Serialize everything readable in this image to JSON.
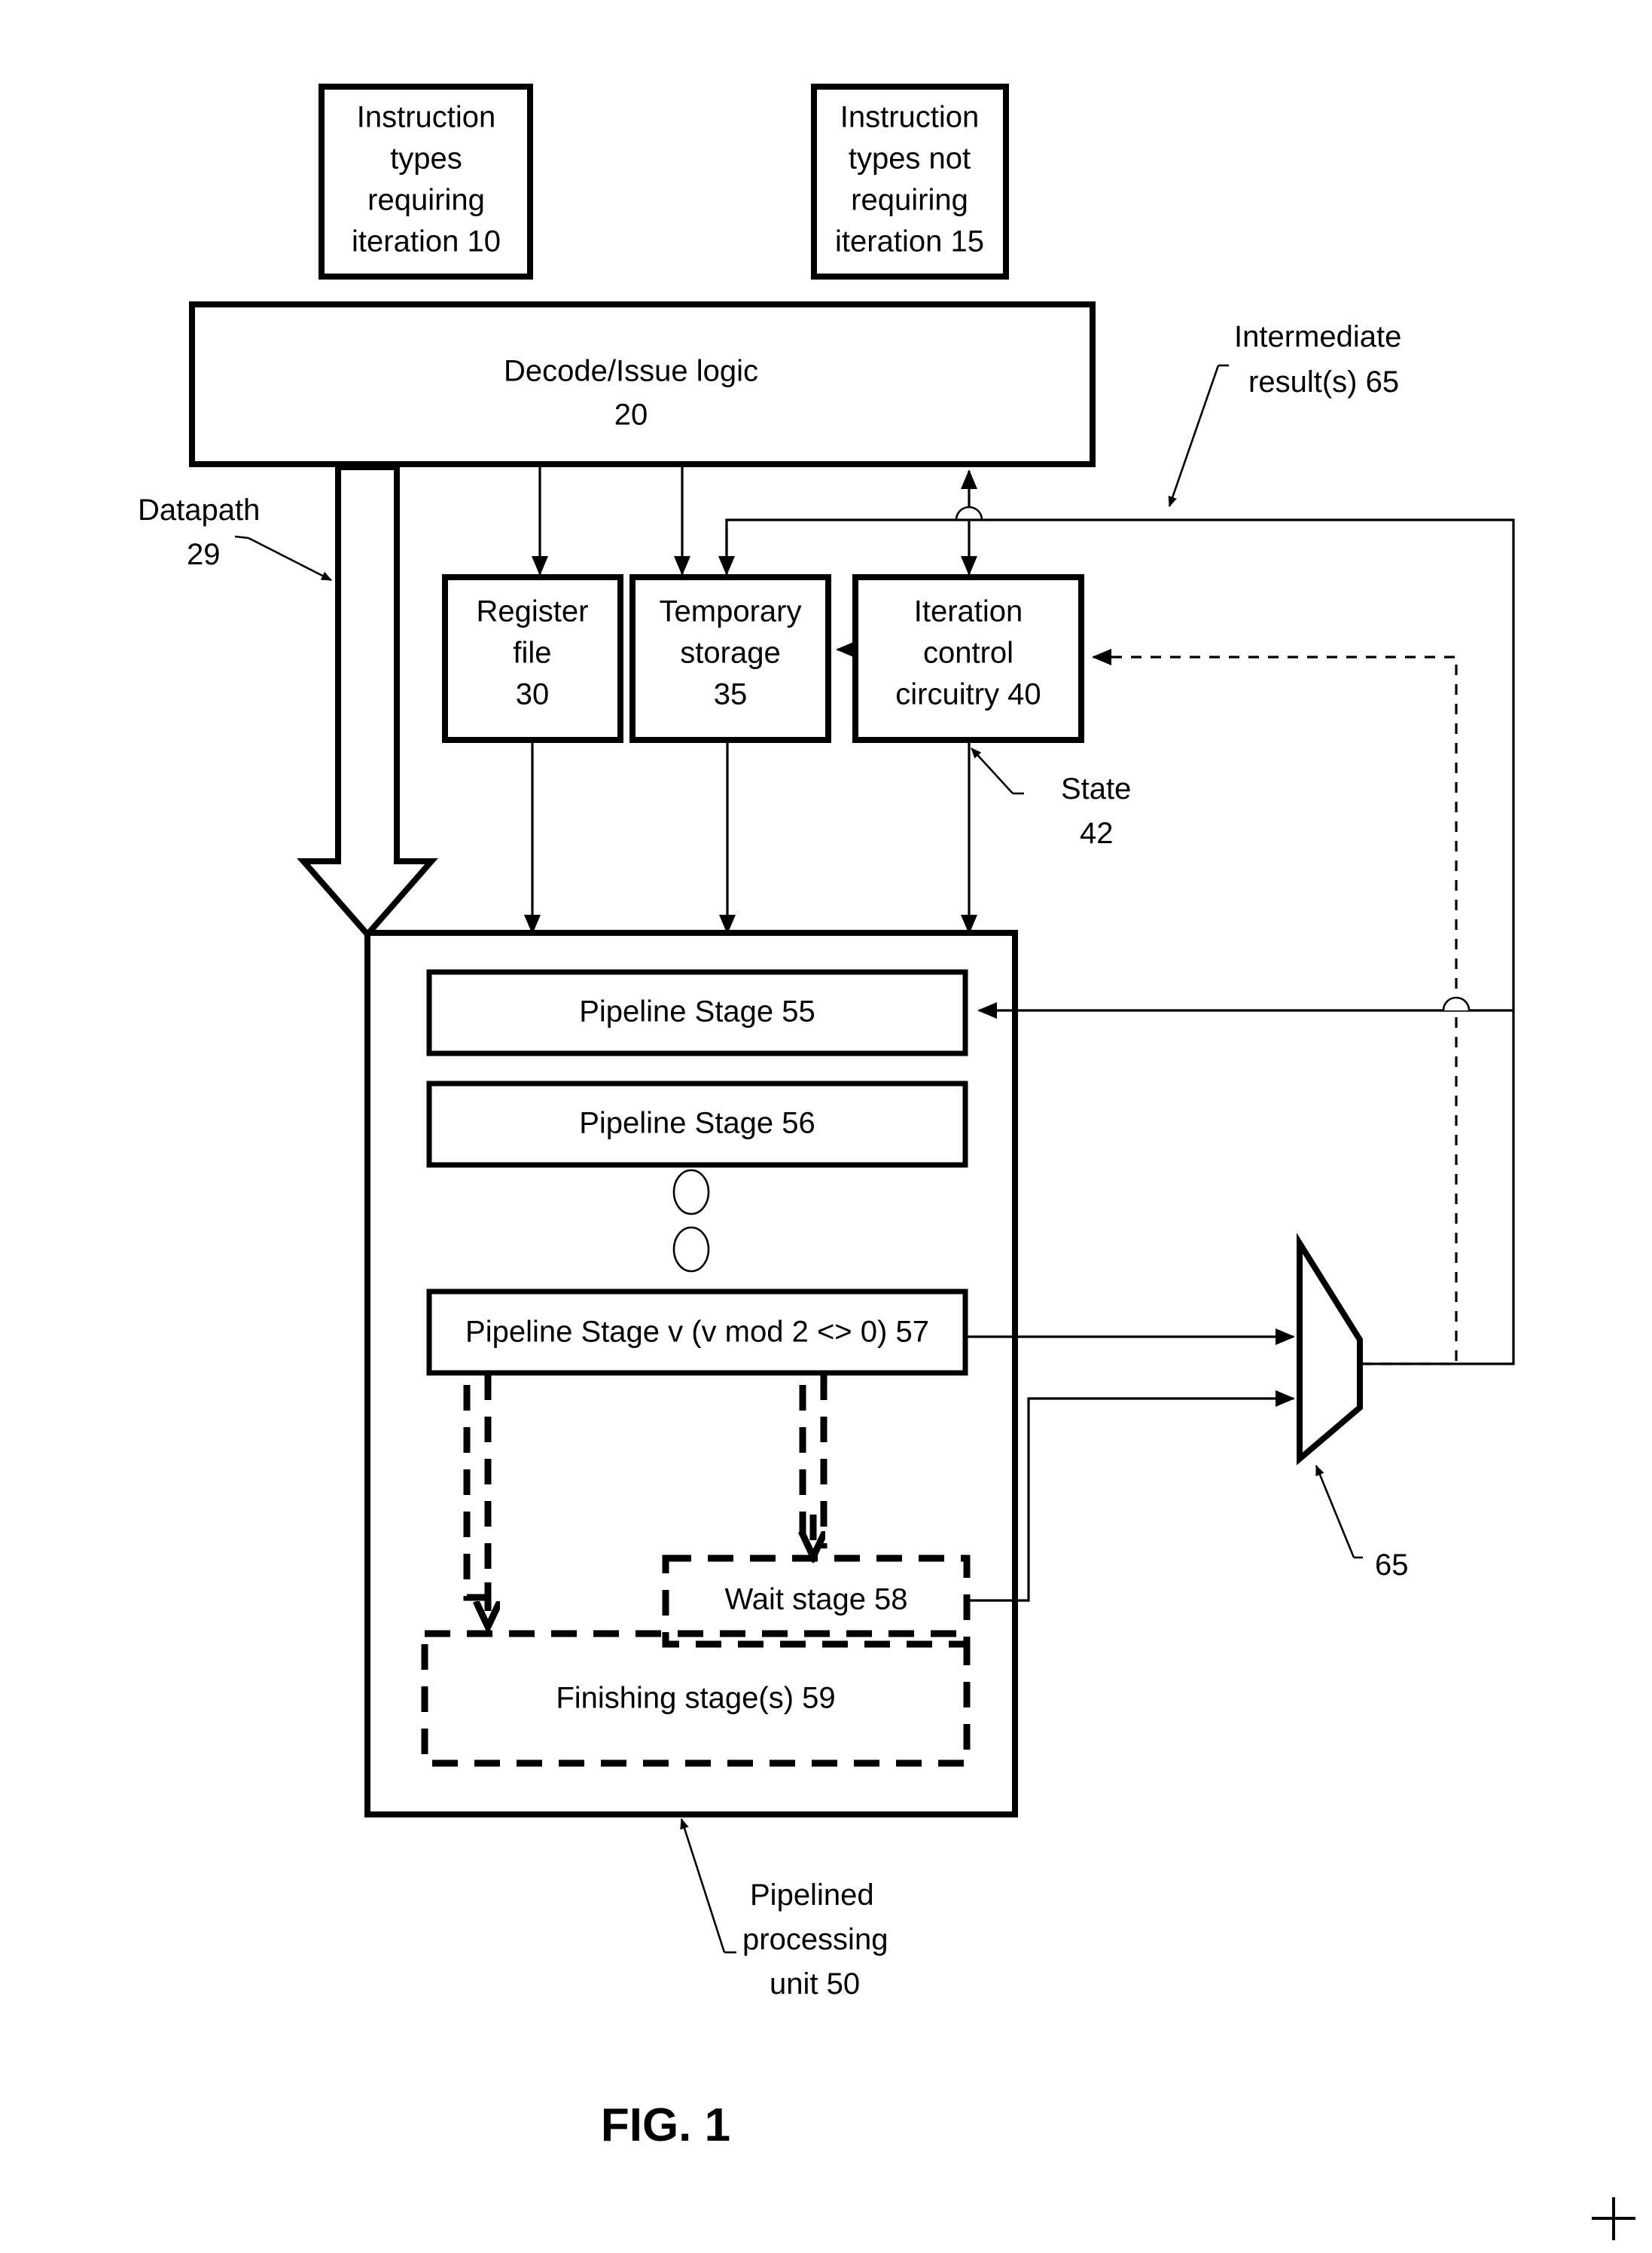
{
  "figure": {
    "caption": "FIG. 1",
    "domain": "patent block diagram"
  },
  "blocks": {
    "instr_iter": {
      "lines": [
        "Instruction",
        "types",
        "requiring",
        "iteration 10"
      ],
      "ref": "10"
    },
    "instr_no_iter": {
      "lines": [
        "Instruction",
        "types not",
        "requiring",
        "iteration 15"
      ],
      "ref": "15"
    },
    "decode": {
      "lines": [
        "Decode/Issue logic",
        "20"
      ],
      "ref": "20"
    },
    "regfile": {
      "lines": [
        "Register",
        "file",
        "30"
      ],
      "ref": "30"
    },
    "tempstore": {
      "lines": [
        "Temporary",
        "storage",
        "35"
      ],
      "ref": "35"
    },
    "itercontrol": {
      "lines": [
        "Iteration",
        "control",
        "circuitry 40"
      ],
      "ref": "40"
    },
    "stage55": {
      "label": "Pipeline Stage 55",
      "ref": "55"
    },
    "stage56": {
      "label": "Pipeline Stage 56",
      "ref": "56"
    },
    "stage57": {
      "label": "Pipeline Stage v (v mod 2 <> 0) 57",
      "ref": "57"
    },
    "wait58": {
      "label": "Wait stage 58",
      "ref": "58"
    },
    "finish59": {
      "label": "Finishing stage(s) 59",
      "ref": "59"
    }
  },
  "callouts": {
    "datapath": {
      "lines": [
        "Datapath",
        "29"
      ],
      "ref": "29"
    },
    "intermediate": {
      "lines": [
        "Intermediate",
        "result(s) 65"
      ],
      "ref": "65"
    },
    "state": {
      "lines": [
        "State",
        "42"
      ],
      "ref": "42"
    },
    "mux": {
      "lines": [
        "65"
      ],
      "ref": "65"
    },
    "pipelined_unit": {
      "lines": [
        "Pipelined",
        "processing",
        "unit 50"
      ],
      "ref": "50"
    }
  },
  "colors": {
    "ink": "#000000",
    "paper": "#ffffff"
  }
}
